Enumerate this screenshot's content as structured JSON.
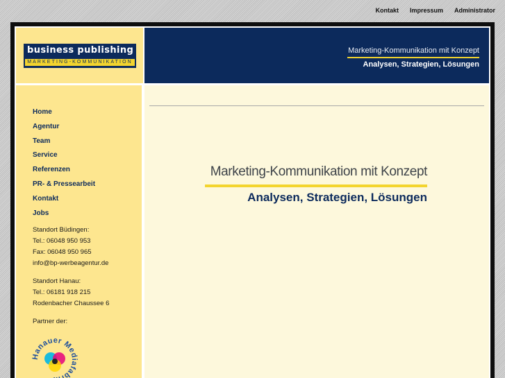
{
  "topnav": [
    "Kontakt",
    "Impressum",
    "Administrator"
  ],
  "logo": {
    "top": "business publishing",
    "sub": "MARKETING-KOMMUNIKATION"
  },
  "header": {
    "line1": "Marketing-Kommunikation mit Konzept",
    "line2": "Analysen, Strategien, Lösungen"
  },
  "nav": [
    "Home",
    "Agentur",
    "Team",
    "Service",
    "Referenzen",
    "PR- & Pressearbeit",
    "Kontakt",
    "Jobs"
  ],
  "contact1": {
    "title": "Standort Büdingen:",
    "tel": "Tel.: 06048 950 953",
    "fax": "Fax: 06048 950 965",
    "email": "info@bp-werbeagentur.de"
  },
  "contact2": {
    "title": "Standort Hanau:",
    "tel": "Tel.: 06181 918 215",
    "street": "Rodenbacher Chaussee 6"
  },
  "partner": {
    "label": "Partner der:",
    "logo_text": "Hanauer Mediafabrik"
  },
  "hero": {
    "line1": "Marketing-Kommunikation mit Konzept",
    "line2": "Analysen, Strategien, Lösungen"
  },
  "colors": {
    "navy": "#0c2a5c",
    "yellow": "#f3d42e",
    "sidebar": "#fde68f",
    "content": "#fdf8dc"
  }
}
